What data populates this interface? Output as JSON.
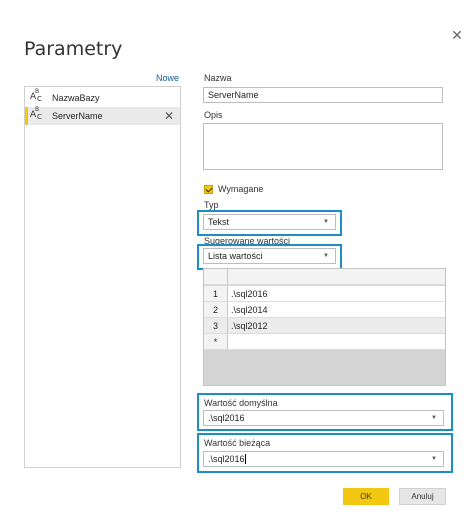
{
  "dialog": {
    "title": "Parametry",
    "close_glyph": "✕",
    "new_label": "Nowe"
  },
  "param_list": {
    "items": [
      {
        "name": "NazwaBazy",
        "selected": false
      },
      {
        "name": "ServerName",
        "selected": true
      }
    ],
    "delete_glyph": "✕"
  },
  "form": {
    "name_label": "Nazwa",
    "name_value": "ServerName",
    "desc_label": "Opis",
    "desc_value": "",
    "required_label": "Wymagane",
    "required_checked": true,
    "type_label": "Typ",
    "type_value": "Tekst",
    "suggested_label": "Sugerowane wartości",
    "suggested_value": "Lista wartości",
    "values_table": {
      "rows": [
        {
          "num": "1",
          "value": ".\\sql2016"
        },
        {
          "num": "2",
          "value": ".\\sql2014"
        },
        {
          "num": "3",
          "value": ".\\sql2012"
        },
        {
          "num": "*",
          "value": ""
        }
      ]
    },
    "default_label": "Wartość domyślna",
    "default_value": ".\\sql2016",
    "current_label": "Wartość bieżąca",
    "current_value": ".\\sql2016"
  },
  "buttons": {
    "ok": "OK",
    "cancel": "Anuluj"
  },
  "icons": {
    "type_icon": "abc-text-icon",
    "caret": "▼"
  },
  "colors": {
    "accent": "#f2c811",
    "highlight": "#1b8ec6",
    "link": "#0f5fa8"
  }
}
